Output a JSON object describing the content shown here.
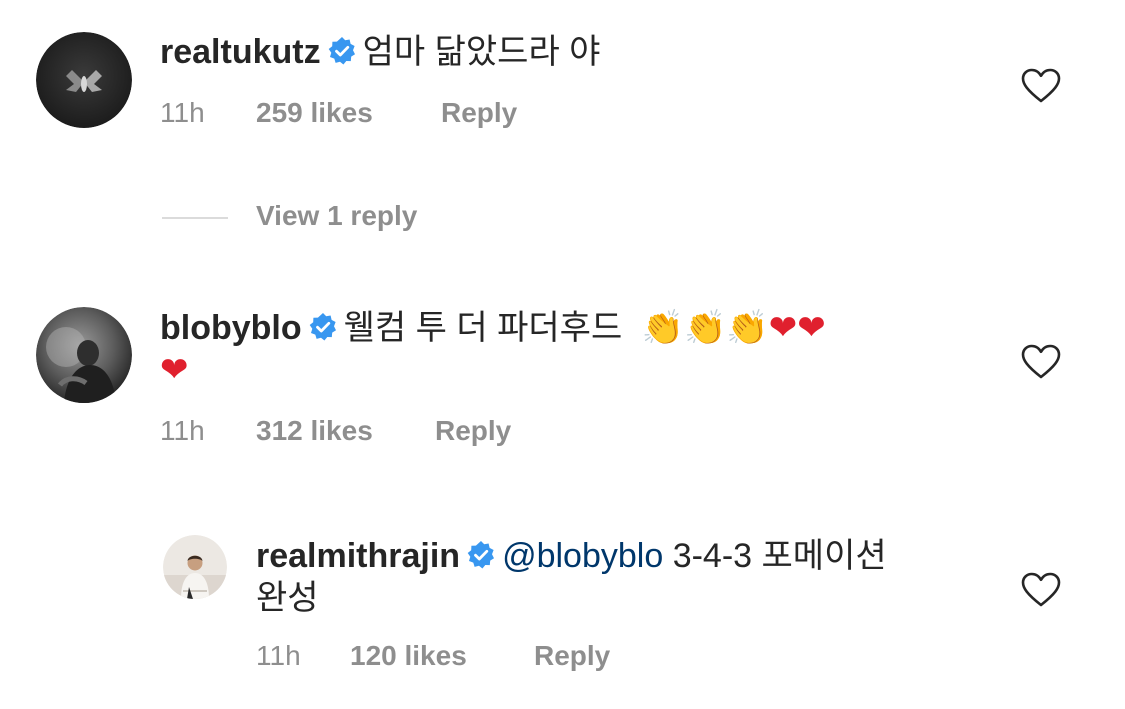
{
  "comments": [
    {
      "username": "realtukutz",
      "verified": true,
      "text": "엄마 닮았드라 야",
      "time": "11h",
      "likes": "259 likes",
      "reply_label": "Reply",
      "view_replies_label": "View 1 reply"
    },
    {
      "username": "blobyblo",
      "verified": true,
      "text": "웰컴 투 더 파더후드",
      "emojis": [
        "👏",
        "👏",
        "👏",
        "❤",
        "❤",
        "❤"
      ],
      "time": "11h",
      "likes": "312 likes",
      "reply_label": "Reply"
    }
  ],
  "replies": [
    {
      "username": "realmithrajin",
      "verified": true,
      "mention": "@blobyblo",
      "text_line1": "3-4-3 포메이션",
      "text_line2": "완성",
      "time": "11h",
      "likes": "120 likes",
      "reply_label": "Reply"
    }
  ],
  "icons": {
    "like": "heart-outline-icon",
    "verified": "verified-badge-icon",
    "clap": "clapping-hands-emoji",
    "heart": "red-heart-emoji"
  },
  "colors": {
    "text": "#262626",
    "secondary": "#8e8e8e",
    "verified": "#3897f0",
    "mention": "#00376b",
    "heart_emoji": "#e0202e"
  }
}
